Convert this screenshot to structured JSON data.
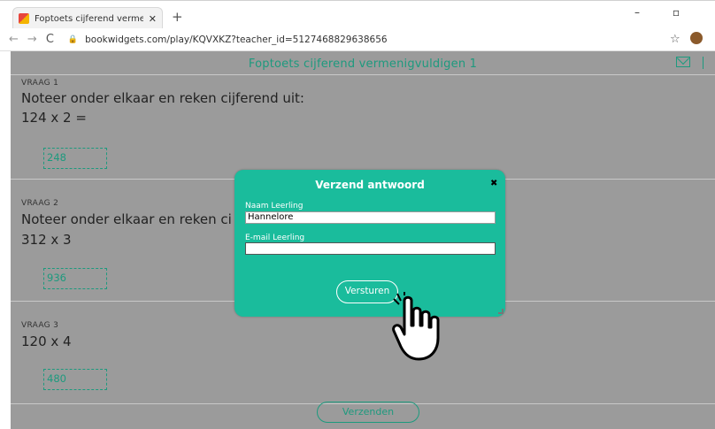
{
  "browser": {
    "tab_title": "Foptoets cijferend vermenigvuldi",
    "tab_close": "✕",
    "new_tab": "+",
    "minimize": "–",
    "maximize": "▫",
    "back": "←",
    "forward": "→",
    "reload": "C",
    "url": "bookwidgets.com/play/KQVXKZ?teacher_id=5127468829638656"
  },
  "page": {
    "title": "Foptoets cijferend vermenigvuldigen 1",
    "submit_label": "Verzenden"
  },
  "questions": [
    {
      "label": "VRAAG 1",
      "line1": "Noteer onder elkaar en reken cijferend uit:",
      "line2": "124 x 2 =",
      "answer": "248"
    },
    {
      "label": "VRAAG 2",
      "line1": "Noteer onder elkaar en reken ci",
      "line2": "312 x 3",
      "answer": "936"
    },
    {
      "label": "VRAAG 3",
      "line1": "120 x 4",
      "answer": "480"
    }
  ],
  "modal": {
    "title": "Verzend antwoord",
    "close": "✖",
    "name_label": "Naam Leerling",
    "name_value": "Hannelore",
    "email_label": "E-mail Leerling",
    "email_value": "",
    "button": "Versturen"
  },
  "colors": {
    "accent": "#1abc9c",
    "overlay": "#9b9b9b",
    "text": "#1d9a7e"
  }
}
